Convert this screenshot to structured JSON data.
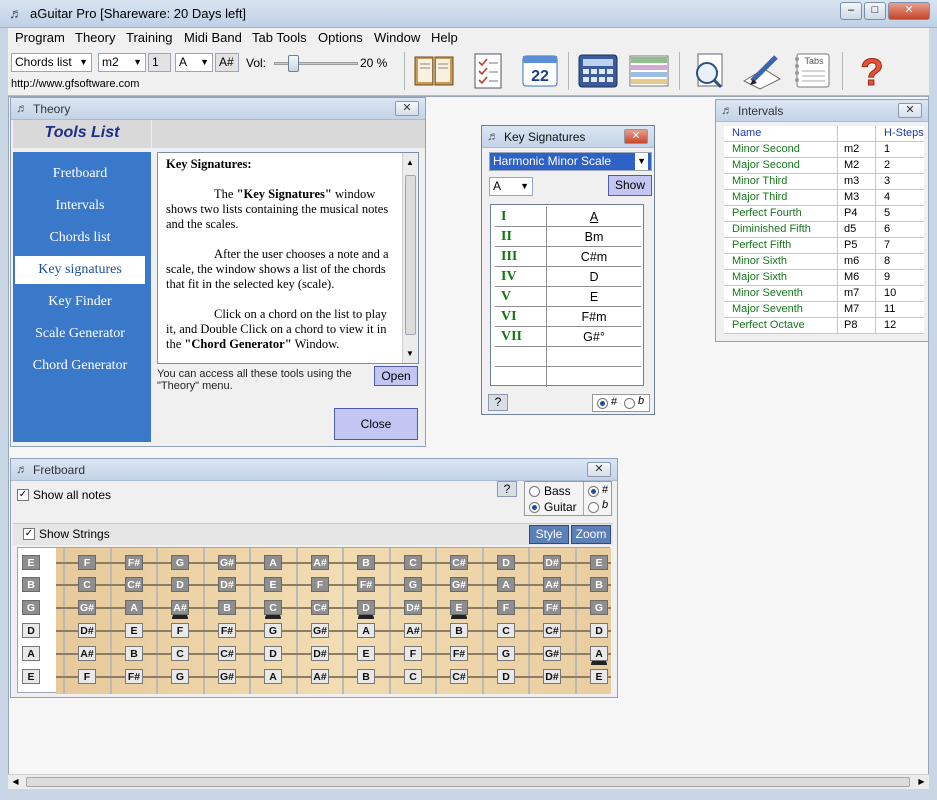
{
  "app": {
    "title": "aGuitar Pro [Shareware: 20 Days left]",
    "url": "http://www.gfsoftware.com"
  },
  "menu": [
    "Program",
    "Theory",
    "Training",
    "Midi Band",
    "Tab Tools",
    "Options",
    "Window",
    "Help"
  ],
  "toolbar": {
    "tool_select": "Chords list",
    "interval_select": "m2",
    "interval_value": "1",
    "note_select": "A",
    "note_result": "A#",
    "volume_label": "Vol:",
    "volume_value": "20 %",
    "volume_level": 0.2,
    "icons": [
      "book-icon",
      "checklist-icon",
      "calendar-icon",
      "calculator-icon",
      "table-icon",
      "search-doc-icon",
      "pen-icon",
      "tabs-icon",
      "help-icon"
    ],
    "tabs_icon_label": "Tabs",
    "calendar_number": "22"
  },
  "theory": {
    "title": "Theory",
    "tools_header": "Tools List",
    "items": [
      "Fretboard",
      "Intervals",
      "Chords list",
      "Key signatures",
      "Key Finder",
      "Scale Generator",
      "Chord Generator"
    ],
    "selected": "Key signatures",
    "text_title": "Key Signatures:",
    "para1_pre": "The ",
    "para1_bold": "\"Key Signatures\"",
    "para1_post": " window shows two lists containing the musical notes and the scales.",
    "para2": "After the user chooses a note and a scale, the window shows a list of the chords that fit in the selected key (scale).",
    "para3_pre": "Click on a chord on the list to play it, and Double Click on a chord to view it in the ",
    "para3_bold": "\"Chord Generator\"",
    "para3_post": " Window.",
    "access_text": "You can access all these tools using  the \"Theory\" menu.",
    "open_button": "Open",
    "close_button": "Close"
  },
  "key_signatures": {
    "title": "Key Signatures",
    "scale": "Harmonic Minor Scale",
    "note": "A",
    "show_button": "Show",
    "rows": [
      {
        "degree": "I",
        "chord": "A"
      },
      {
        "degree": "II",
        "chord": "Bm"
      },
      {
        "degree": "III",
        "chord": "C#m"
      },
      {
        "degree": "IV",
        "chord": "D"
      },
      {
        "degree": "V",
        "chord": "E"
      },
      {
        "degree": "VI",
        "chord": "F#m"
      },
      {
        "degree": "VII",
        "chord": "G#°"
      }
    ],
    "help_button": "?",
    "sharp_label": "#",
    "flat_label": "b",
    "accidental": "#"
  },
  "intervals": {
    "title": "Intervals",
    "headers": {
      "name": "Name",
      "abbr": "",
      "steps": "H-Steps"
    },
    "rows": [
      {
        "name": "Minor Second",
        "abbr": "m2",
        "steps": "1"
      },
      {
        "name": "Major Second",
        "abbr": "M2",
        "steps": "2"
      },
      {
        "name": "Minor Third",
        "abbr": "m3",
        "steps": "3"
      },
      {
        "name": "Major Third",
        "abbr": "M3",
        "steps": "4"
      },
      {
        "name": "Perfect Fourth",
        "abbr": "P4",
        "steps": "5"
      },
      {
        "name": "Diminished Fifth",
        "abbr": "d5",
        "steps": "6"
      },
      {
        "name": "Perfect Fifth",
        "abbr": "P5",
        "steps": "7"
      },
      {
        "name": "Minor Sixth",
        "abbr": "m6",
        "steps": "8"
      },
      {
        "name": "Major Sixth",
        "abbr": "M6",
        "steps": "9"
      },
      {
        "name": "Minor Seventh",
        "abbr": "m7",
        "steps": "10"
      },
      {
        "name": "Major Seventh",
        "abbr": "M7",
        "steps": "11"
      },
      {
        "name": "Perfect Octave",
        "abbr": "P8",
        "steps": "12"
      }
    ]
  },
  "fretboard": {
    "title": "Fretboard",
    "show_all_notes": "Show all notes",
    "show_strings": "Show Strings",
    "help_button": "?",
    "bass_label": "Bass",
    "guitar_label": "Guitar",
    "instrument": "Guitar",
    "sharp_label": "#",
    "flat_label": "b",
    "accidental": "#",
    "style_button": "Style",
    "zoom_button": "Zoom",
    "strings": [
      [
        "E",
        "F",
        "F#",
        "G",
        "G#",
        "A",
        "A#",
        "B",
        "C",
        "C#",
        "D",
        "D#",
        "E"
      ],
      [
        "B",
        "C",
        "C#",
        "D",
        "D#",
        "E",
        "F",
        "F#",
        "G",
        "G#",
        "A",
        "A#",
        "B"
      ],
      [
        "G",
        "G#",
        "A",
        "A#",
        "B",
        "C",
        "C#",
        "D",
        "D#",
        "E",
        "F",
        "F#",
        "G"
      ],
      [
        "D",
        "D#",
        "E",
        "F",
        "F#",
        "G",
        "G#",
        "A",
        "A#",
        "B",
        "C",
        "C#",
        "D"
      ],
      [
        "A",
        "A#",
        "B",
        "C",
        "C#",
        "D",
        "D#",
        "E",
        "F",
        "F#",
        "G",
        "G#",
        "A"
      ],
      [
        "E",
        "F",
        "F#",
        "G",
        "G#",
        "A",
        "A#",
        "B",
        "C",
        "C#",
        "D",
        "D#",
        "E"
      ]
    ]
  },
  "colors": {
    "accent": "#3a79c9",
    "button": "#c3c6f2",
    "roman": "#0f7a0f",
    "interval_name": "#18771d"
  }
}
